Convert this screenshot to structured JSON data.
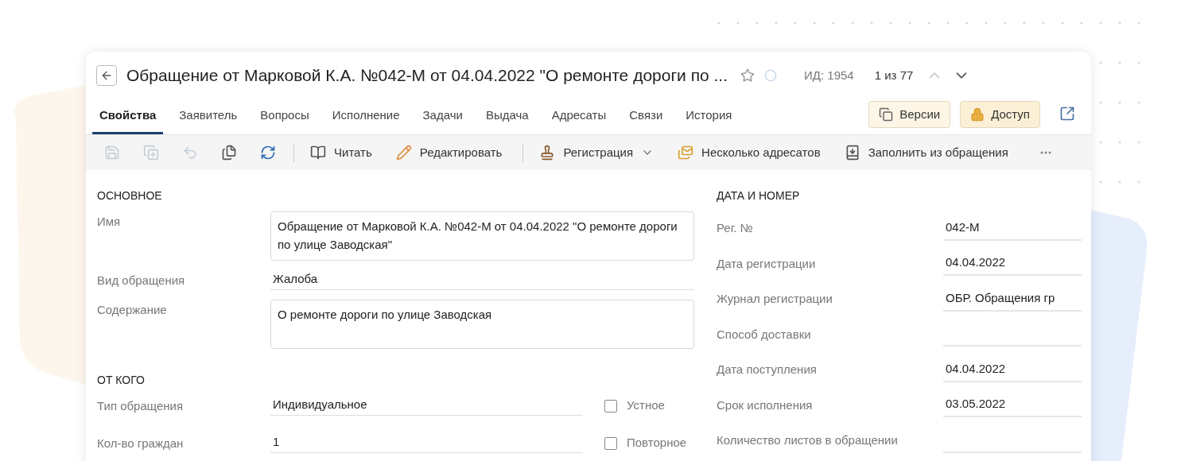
{
  "header": {
    "title": "Обращение от Марковой К.А. №042-М от 04.04.2022 \"О ремонте дороги по ...",
    "favorite": false,
    "id_label": "ИД: 1954",
    "counter": "1 из 77"
  },
  "tabs": [
    {
      "label": "Свойства",
      "selected": true
    },
    {
      "label": "Заявитель",
      "selected": false
    },
    {
      "label": "Вопросы",
      "selected": false
    },
    {
      "label": "Исполнение",
      "selected": false
    },
    {
      "label": "Задачи",
      "selected": false
    },
    {
      "label": "Выдача",
      "selected": false
    },
    {
      "label": "Адресаты",
      "selected": false
    },
    {
      "label": "Связи",
      "selected": false
    },
    {
      "label": "История",
      "selected": false
    }
  ],
  "header_buttons": [
    {
      "label": "Версии",
      "kind": "versions"
    },
    {
      "label": "Доступ",
      "kind": "access"
    }
  ],
  "toolbar": [
    {
      "kind": "icon",
      "disabled": true
    },
    {
      "kind": "icon",
      "disabled": true
    },
    {
      "kind": "icon",
      "disabled": true
    },
    {
      "kind": "icon",
      "disabled": false
    },
    {
      "kind": "icon",
      "disabled": false
    },
    {
      "kind": "separator"
    },
    {
      "kind": "labeled",
      "label": "Читать"
    },
    {
      "kind": "labeled",
      "label": "Редактировать"
    },
    {
      "kind": "separator"
    },
    {
      "kind": "menu",
      "label": "Регистрация"
    },
    {
      "kind": "labeled",
      "label": "Несколько адресатов"
    },
    {
      "kind": "labeled",
      "label": "Заполнить из обращения"
    },
    {
      "kind": "more"
    }
  ],
  "left_sections": [
    {
      "title": "ОСНОВНОЕ",
      "fields": [
        {
          "label": "Имя",
          "value": "Обращение от Марковой К.А. №042-М от 04.04.2022 \"О ремонте дороги по улице Заводская\"",
          "kind": "textarea"
        },
        {
          "label": "Вид обращения",
          "value": "Жалоба",
          "kind": "line"
        },
        {
          "label": "Содержание",
          "value": "О ремонте дороги по улице Заводская",
          "kind": "textarea"
        }
      ]
    },
    {
      "title": "ОТ КОГО",
      "fields": [
        {
          "label": "Тип обращения",
          "value": "Индивидуальное",
          "kind": "line",
          "checkbox": {
            "label": "Устное",
            "checked": false
          }
        },
        {
          "label": "Кол-во граждан",
          "value": "1",
          "kind": "line",
          "checkbox": {
            "label": "Повторное",
            "checked": false
          }
        }
      ]
    }
  ],
  "right_section": {
    "title": "ДАТА И НОМЕР",
    "fields": [
      {
        "label": "Рег. №",
        "value": "042-М"
      },
      {
        "label": "Дата регистрации",
        "value": "04.04.2022"
      },
      {
        "label": "Журнал регистрации",
        "value": "ОБР. Обращения гр"
      },
      {
        "label": "Способ доставки"
      },
      {
        "label": "Дата поступления",
        "value": "04.04.2022"
      },
      {
        "label": "Срок исполнения",
        "value": "03.05.2022"
      },
      {
        "label": "Количество листов в обращении"
      }
    ]
  }
}
